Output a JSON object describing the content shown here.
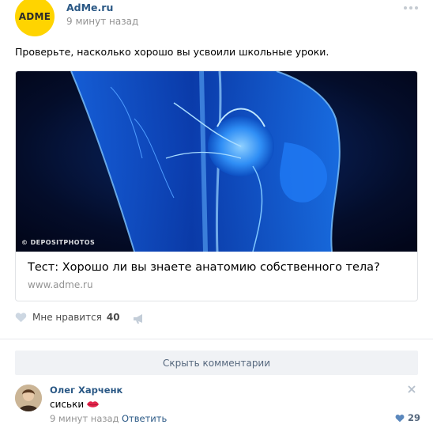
{
  "post": {
    "author": "AdMe.ru",
    "avatar_text": "ADME",
    "time": "9 минут назад",
    "text": "Проверьте, насколько хорошо вы усвоили школьные уроки.",
    "attachment": {
      "watermark": "© DEPOSITPHOTOS",
      "title": "Тест: Хорошо ли вы знаете анатомию собственного тела?",
      "domain": "www.adme.ru"
    },
    "likes_label": "Мне нравится",
    "likes_count": "40"
  },
  "hide_comments_label": "Скрыть комментарии",
  "comment": {
    "author": "Олег Харченк",
    "text": "сиськи",
    "time": "9 минут назад",
    "reply_label": "Ответить",
    "likes_count": "29"
  },
  "colors": {
    "link": "#2a5885",
    "muted": "#939393",
    "brand_yellow": "#ffd400",
    "image_blue": "#0b5fd6"
  },
  "icons": [
    "more-icon",
    "heart-icon",
    "megaphone-icon",
    "close-icon",
    "lips-icon"
  ]
}
